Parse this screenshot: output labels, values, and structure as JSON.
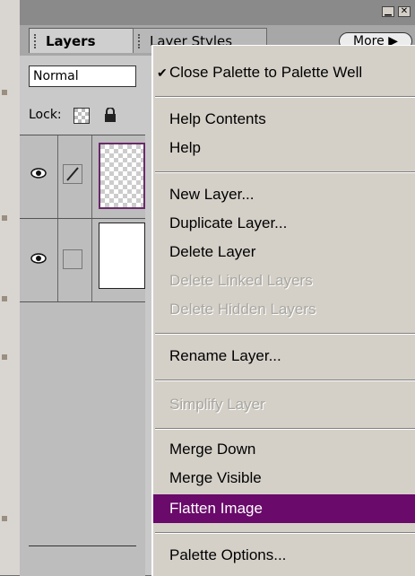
{
  "palette": {
    "tabs": [
      {
        "label": "Layers"
      },
      {
        "label": "Layer Styles"
      }
    ],
    "more_button": "More",
    "blend_mode": "Normal",
    "lock_label": "Lock:",
    "window_buttons": {
      "minimize": "▁",
      "close": "✕"
    }
  },
  "menu": {
    "close_palette": "Close Palette to Palette Well",
    "help_contents": "Help Contents",
    "help": "Help",
    "new_layer": "New Layer...",
    "duplicate_layer": "Duplicate Layer...",
    "delete_layer": "Delete Layer",
    "delete_linked": "Delete Linked Layers",
    "delete_hidden": "Delete Hidden Layers",
    "rename_layer": "Rename Layer...",
    "simplify_layer": "Simplify Layer",
    "merge_down": "Merge Down",
    "merge_visible": "Merge Visible",
    "flatten_image": "Flatten Image",
    "palette_options": "Palette Options..."
  },
  "colors": {
    "highlight": "#6a0a6a",
    "menu_bg": "#d4d0c8",
    "disabled_text": "#a8a6a0"
  },
  "icons": {
    "check": "checkmark-icon",
    "eye": "eye-icon",
    "brush": "brush-icon",
    "lock": "lock-icon",
    "transparency_lock": "transparency-lock-icon",
    "more_arrow": "triangle-right-icon"
  }
}
